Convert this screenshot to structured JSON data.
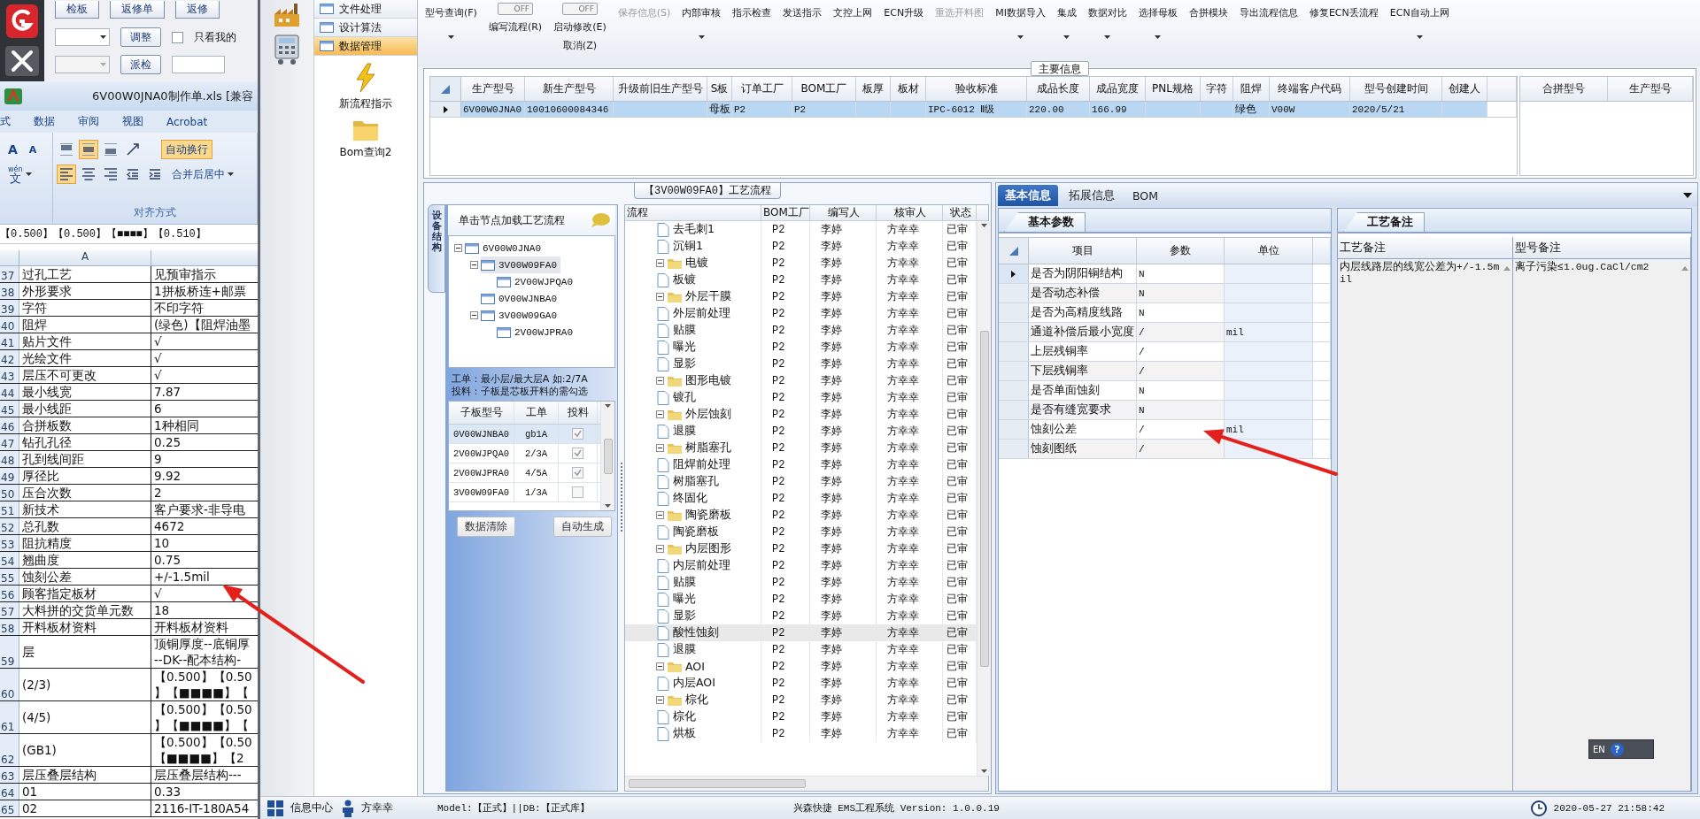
{
  "left_app": {
    "top_buttons": [
      "检板",
      "返修单",
      "返修"
    ],
    "adjust_button": "调整",
    "filter_checkbox": {
      "label": "只看我的",
      "checked": false
    },
    "dispatch_button": "派检"
  },
  "excel": {
    "title": "6V00W0JNA0制作单.xls [兼容",
    "ribbon": {
      "tabs": [
        "式",
        "数据",
        "审阅",
        "视图",
        "Acrobat"
      ],
      "font_buttons": [
        "A",
        "A"
      ],
      "phonetic": {
        "top": "wén",
        "main": "文"
      },
      "valign": [
        {
          "selected": false
        },
        {
          "selected": true
        },
        {
          "selected": false
        }
      ],
      "halign": [
        {
          "selected": true
        },
        {
          "selected": false
        },
        {
          "selected": false
        }
      ],
      "wrap": {
        "label": "自动换行",
        "on": true
      },
      "merge": "合并后居中",
      "group_label": "对齐方式"
    },
    "formula": "【0.500】【0.500】【■■■■】【0.510】",
    "column_header": "A",
    "rows": [
      {
        "n": "37",
        "a": "过孔工艺",
        "b": [
          "见预审指示"
        ]
      },
      {
        "n": "38",
        "a": "外形要求",
        "b": [
          "1拼板桥连+邮票"
        ]
      },
      {
        "n": "39",
        "a": "字符",
        "b": [
          "不印字符"
        ]
      },
      {
        "n": "40",
        "a": "阻焊",
        "b": [
          "(绿色)【阻焊油墨"
        ]
      },
      {
        "n": "41",
        "a": "贴片文件",
        "b": [
          "√"
        ]
      },
      {
        "n": "42",
        "a": "光绘文件",
        "b": [
          "√"
        ]
      },
      {
        "n": "43",
        "a": "层压不可更改",
        "b": [
          "√"
        ]
      },
      {
        "n": "44",
        "a": "最小线宽",
        "b": [
          "7.87"
        ]
      },
      {
        "n": "45",
        "a": "最小线距",
        "b": [
          "6"
        ]
      },
      {
        "n": "46",
        "a": "合拼板数",
        "b": [
          "1种相同"
        ]
      },
      {
        "n": "47",
        "a": "钻孔孔径",
        "b": [
          "0.25"
        ]
      },
      {
        "n": "48",
        "a": "孔到线间距",
        "b": [
          "9"
        ]
      },
      {
        "n": "49",
        "a": "厚径比",
        "b": [
          "9.92"
        ]
      },
      {
        "n": "50",
        "a": "压合次数",
        "b": [
          "2"
        ]
      },
      {
        "n": "51",
        "a": "新技术",
        "b": [
          "客户要求-非导电"
        ]
      },
      {
        "n": "52",
        "a": "总孔数",
        "b": [
          "4672"
        ]
      },
      {
        "n": "53",
        "a": "阻抗精度",
        "b": [
          "10"
        ]
      },
      {
        "n": "54",
        "a": "翘曲度",
        "b": [
          "0.75"
        ]
      },
      {
        "n": "55",
        "a": "蚀刻公差",
        "b": [
          "+/-1.5mil"
        ]
      },
      {
        "n": "56",
        "a": "顾客指定板材",
        "b": [
          "√"
        ]
      },
      {
        "n": "57",
        "a": "大料拼的交货单元数",
        "b": [
          "18"
        ]
      },
      {
        "n": "58",
        "a": "开料板材资料",
        "b": [
          "开料板材资料"
        ]
      },
      {
        "n": "59",
        "a": "层",
        "b": [
          "顶铜厚度--底铜厚",
          "--DK--配本结构-"
        ]
      },
      {
        "n": "60",
        "a": "(2/3)",
        "b": [
          "【0.500】【0.50",
          "】【■■■■】【"
        ]
      },
      {
        "n": "61",
        "a": "(4/5)",
        "b": [
          "【0.500】【0.50",
          "】【■■■■】【"
        ]
      },
      {
        "n": "62",
        "a": "(GB1)",
        "b": [
          "【0.500】【0.50",
          "【■■■■】【2"
        ]
      },
      {
        "n": "63",
        "a": "层压叠层结构",
        "b": [
          "层压叠层结构---"
        ]
      },
      {
        "n": "64",
        "a": "01",
        "b": [
          "0.33"
        ]
      },
      {
        "n": "65",
        "a": "02",
        "b": [
          "2116-IT-180A54"
        ]
      }
    ]
  },
  "nav": {
    "items": [
      {
        "label": "文件处理",
        "selected": false
      },
      {
        "label": "设计算法",
        "selected": false
      },
      {
        "label": "数据管理",
        "selected": true
      }
    ],
    "launchers": [
      {
        "kind": "lightning",
        "label": "新流程指示"
      },
      {
        "kind": "folder",
        "label": "Bom查询2"
      }
    ]
  },
  "toolbar": [
    {
      "kind": "button",
      "label": "型号查询(F)",
      "dropdown": true,
      "disabled": false
    },
    {
      "kind": "toggle",
      "switch_text": "OFF",
      "on": false,
      "label": "编写流程(R)"
    },
    {
      "kind": "toggle",
      "switch_text": "OFF",
      "on": false,
      "label": "启动修改(E)",
      "sub_label": "取消(Z)"
    },
    {
      "kind": "button",
      "label": "保存信息(S)",
      "dropdown": false,
      "disabled": true
    },
    {
      "kind": "button",
      "label": "内部审核",
      "dropdown": true,
      "disabled": false
    },
    {
      "kind": "button",
      "label": "指示检查",
      "dropdown": false,
      "disabled": false
    },
    {
      "kind": "button",
      "label": "发送指示",
      "dropdown": false,
      "disabled": false
    },
    {
      "kind": "button",
      "label": "文控上网",
      "dropdown": false,
      "disabled": false
    },
    {
      "kind": "button",
      "label": "ECN升级",
      "dropdown": false,
      "disabled": false
    },
    {
      "kind": "button",
      "label": "重选开料图",
      "dropdown": false,
      "disabled": true
    },
    {
      "kind": "button",
      "label": "MI数据导入",
      "dropdown": true,
      "disabled": false
    },
    {
      "kind": "button",
      "label": "集成",
      "dropdown": true,
      "disabled": false
    },
    {
      "kind": "button",
      "label": "数据对比",
      "dropdown": true,
      "disabled": false
    },
    {
      "kind": "button",
      "label": "选择母板",
      "dropdown": true,
      "disabled": false
    },
    {
      "kind": "button",
      "label": "合拼模块",
      "dropdown": false,
      "disabled": false
    },
    {
      "kind": "button",
      "label": "导出流程信息",
      "dropdown": false,
      "disabled": false
    },
    {
      "kind": "button",
      "label": "修复ECN丢流程",
      "dropdown": false,
      "disabled": false
    },
    {
      "kind": "button",
      "label": "ECN自动上网",
      "dropdown": true,
      "disabled": false
    }
  ],
  "main_info": {
    "title": "主要信息",
    "columns": [
      "生产型号",
      "新生产型号",
      "升级前旧生产型号",
      "S板",
      "订单工厂",
      "BOM工厂",
      "板厚",
      "板材",
      "验收标准",
      "成品长度",
      "成品宽度",
      "PNL规格",
      "字符",
      "阻焊",
      "终端客户代码",
      "型号创建时间",
      "创建人"
    ],
    "rows": [
      {
        "selected": true,
        "cells": [
          "6V00W0JNA0",
          "10010600084346",
          null,
          "母板",
          "P2",
          "P2",
          null,
          null,
          "IPC-6012 Ⅱ级",
          "220.00",
          "166.99",
          null,
          null,
          "绿色",
          "V00W",
          "2020/5/21",
          null
        ]
      }
    ],
    "side_columns": [
      "合拼型号",
      "生产型号"
    ]
  },
  "structure": {
    "title": "【3V00W09FA0】工艺流程",
    "tab": "设备结构",
    "hint": "单击节点加载工艺流程",
    "tree": [
      {
        "label": "6V00W0JNA0",
        "expanded": true,
        "selected": false,
        "children": [
          {
            "label": "3V00W09FA0",
            "expanded": true,
            "selected": true,
            "children": [
              {
                "label": "2V00WJPQA0",
                "selected": false
              }
            ]
          },
          {
            "label": "0V00WJNBA0",
            "selected": false
          },
          {
            "label": "3V00W09GA0",
            "expanded": true,
            "selected": false,
            "children": [
              {
                "label": "2V00WJPRA0",
                "selected": false
              }
            ]
          }
        ]
      }
    ],
    "notes": [
      "工单：最小层/最大层A 如:2/7A",
      "投料：子板是芯板开料的需勾选"
    ],
    "columns": [
      "子板型号",
      "工单",
      "投料"
    ],
    "rows": [
      {
        "board": "0V00WJNBA0",
        "order": "gb1A",
        "feed": true,
        "selected": true
      },
      {
        "board": "2V00WJPQA0",
        "order": "2/3A",
        "feed": true,
        "selected": false
      },
      {
        "board": "2V00WJPRA0",
        "order": "4/5A",
        "feed": true,
        "selected": false
      },
      {
        "board": "3V00W09FA0",
        "order": "1/3A",
        "feed": false,
        "selected": false
      }
    ],
    "buttons": [
      "数据清除",
      "自动生成"
    ]
  },
  "flow": {
    "columns": [
      "流程",
      "BOM工厂",
      "编写人",
      "核审人",
      "状态"
    ],
    "rows": [
      {
        "children": [
          {
            "name": "去毛刺1",
            "bom": "P2",
            "writer": "李婷",
            "reviewer": "方幸幸",
            "status": "已审",
            "selected": false
          },
          {
            "name": "沉铜1",
            "bom": "P2",
            "writer": "李婷",
            "reviewer": "方幸幸",
            "status": "已审",
            "selected": false
          }
        ]
      },
      {
        "name": "电镀",
        "bom": "P2",
        "writer": "李婷",
        "reviewer": "方幸幸",
        "status": "已审",
        "expanded": true,
        "selected": false,
        "children": [
          {
            "name": "板镀",
            "bom": "P2",
            "writer": "李婷",
            "reviewer": "方幸幸",
            "status": "已审",
            "selected": false
          }
        ]
      },
      {
        "name": "外层干膜",
        "bom": "P2",
        "writer": "李婷",
        "reviewer": "方幸幸",
        "status": "已审",
        "expanded": true,
        "selected": false,
        "children": [
          {
            "name": "外层前处理",
            "bom": "P2",
            "writer": "李婷",
            "reviewer": "方幸幸",
            "status": "已审",
            "selected": false
          },
          {
            "name": "贴膜",
            "bom": "P2",
            "writer": "李婷",
            "reviewer": "方幸幸",
            "status": "已审",
            "selected": false
          },
          {
            "name": "曝光",
            "bom": "P2",
            "writer": "李婷",
            "reviewer": "方幸幸",
            "status": "已审",
            "selected": false
          },
          {
            "name": "显影",
            "bom": "P2",
            "writer": "李婷",
            "reviewer": "方幸幸",
            "status": "已审",
            "selected": false
          }
        ]
      },
      {
        "name": "图形电镀",
        "bom": "P2",
        "writer": "李婷",
        "reviewer": "方幸幸",
        "status": "已审",
        "expanded": true,
        "selected": false,
        "children": [
          {
            "name": "镀孔",
            "bom": "P2",
            "writer": "李婷",
            "reviewer": "方幸幸",
            "status": "已审",
            "selected": false
          }
        ]
      },
      {
        "name": "外层蚀刻",
        "bom": "P2",
        "writer": "李婷",
        "reviewer": "方幸幸",
        "status": "已审",
        "expanded": true,
        "selected": false,
        "children": [
          {
            "name": "退膜",
            "bom": "P2",
            "writer": "李婷",
            "reviewer": "方幸幸",
            "status": "已审",
            "selected": false
          }
        ]
      },
      {
        "name": "树脂塞孔",
        "bom": "P2",
        "writer": "李婷",
        "reviewer": "方幸幸",
        "status": "已审",
        "expanded": true,
        "selected": false,
        "children": [
          {
            "name": "阻焊前处理",
            "bom": "P2",
            "writer": "李婷",
            "reviewer": "方幸幸",
            "status": "已审",
            "selected": false
          },
          {
            "name": "树脂塞孔",
            "bom": "P2",
            "writer": "李婷",
            "reviewer": "方幸幸",
            "status": "已审",
            "selected": false
          },
          {
            "name": "终固化",
            "bom": "P2",
            "writer": "李婷",
            "reviewer": "方幸幸",
            "status": "已审",
            "selected": false
          }
        ]
      },
      {
        "name": "陶瓷磨板",
        "bom": "P2",
        "writer": "李婷",
        "reviewer": "方幸幸",
        "status": "已审",
        "expanded": true,
        "selected": false,
        "children": [
          {
            "name": "陶瓷磨板",
            "bom": "P2",
            "writer": "李婷",
            "reviewer": "方幸幸",
            "status": "已审",
            "selected": false
          }
        ]
      },
      {
        "name": "内层图形",
        "bom": "P2",
        "writer": "李婷",
        "reviewer": "方幸幸",
        "status": "已审",
        "expanded": true,
        "selected": false,
        "children": [
          {
            "name": "内层前处理",
            "bom": "P2",
            "writer": "李婷",
            "reviewer": "方幸幸",
            "status": "已审",
            "selected": false
          },
          {
            "name": "贴膜",
            "bom": "P2",
            "writer": "李婷",
            "reviewer": "方幸幸",
            "status": "已审",
            "selected": false
          },
          {
            "name": "曝光",
            "bom": "P2",
            "writer": "李婷",
            "reviewer": "方幸幸",
            "status": "已审",
            "selected": false
          },
          {
            "name": "显影",
            "bom": "P2",
            "writer": "李婷",
            "reviewer": "方幸幸",
            "status": "已审",
            "selected": false
          },
          {
            "name": "酸性蚀刻",
            "bom": "P2",
            "writer": "李婷",
            "reviewer": "方幸幸",
            "status": "已审",
            "selected": true
          },
          {
            "name": "退膜",
            "bom": "P2",
            "writer": "李婷",
            "reviewer": "方幸幸",
            "status": "已审",
            "selected": false
          }
        ]
      },
      {
        "name": "AOI",
        "bom": "P2",
        "writer": "李婷",
        "reviewer": "方幸幸",
        "status": "已审",
        "expanded": true,
        "selected": false,
        "children": [
          {
            "name": "内层AOI",
            "bom": "P2",
            "writer": "李婷",
            "reviewer": "方幸幸",
            "status": "已审",
            "selected": false
          }
        ]
      },
      {
        "name": "棕化",
        "bom": "P2",
        "writer": "李婷",
        "reviewer": "方幸幸",
        "status": "已审",
        "expanded": true,
        "selected": false,
        "children": [
          {
            "name": "棕化",
            "bom": "P2",
            "writer": "李婷",
            "reviewer": "方幸幸",
            "status": "已审",
            "selected": false
          },
          {
            "name": "烘板",
            "bom": "P2",
            "writer": "李婷",
            "reviewer": "方幸幸",
            "status": "已审",
            "selected": false
          }
        ]
      }
    ]
  },
  "details": {
    "tabs": [
      {
        "label": "基本信息",
        "selected": true
      },
      {
        "label": "拓展信息",
        "selected": false
      },
      {
        "label": "BOM",
        "selected": false
      }
    ],
    "params": {
      "tab": "基本参数",
      "columns": [
        "项目",
        "参数",
        "单位"
      ],
      "rows": [
        {
          "item": "是否为阴阳铜结构",
          "value": "N",
          "selected": true
        },
        {
          "item": "是否动态补偿",
          "value": "N",
          "selected": false
        },
        {
          "item": "是否为高精度线路",
          "value": "N",
          "selected": false
        },
        {
          "item": "通道补偿后最小宽度",
          "value": "/",
          "unit": "mil",
          "selected": false
        },
        {
          "item": "上层残铜率",
          "value": "/",
          "selected": false
        },
        {
          "item": "下层残铜率",
          "value": "/",
          "selected": false
        },
        {
          "item": "是否单面蚀刻",
          "value": "N",
          "selected": false
        },
        {
          "item": "是否有缝宽要求",
          "value": "N",
          "selected": false
        },
        {
          "item": "蚀刻公差",
          "value": "/",
          "unit": "mil",
          "selected": false
        },
        {
          "item": "蚀刻图纸",
          "value": "/",
          "selected": false
        }
      ]
    },
    "notes": {
      "tab": "工艺备注",
      "columns": [
        "工艺备注",
        "型号备注"
      ],
      "values": [
        "内层线路层的线宽公差为+/-1.5mil",
        "离子污染≤1.0ug.CaCl/cm2"
      ]
    }
  },
  "language_bar": {
    "lang": "EN",
    "help": "?"
  },
  "status_bar": {
    "info_center": "信息中心",
    "user": "方幸幸",
    "env": "Model:【正式】||DB:【正式库】",
    "product": "兴森快捷 EMS工程系统 Version: 1.0.0.19",
    "time": "2020-05-27 21:58:42"
  }
}
